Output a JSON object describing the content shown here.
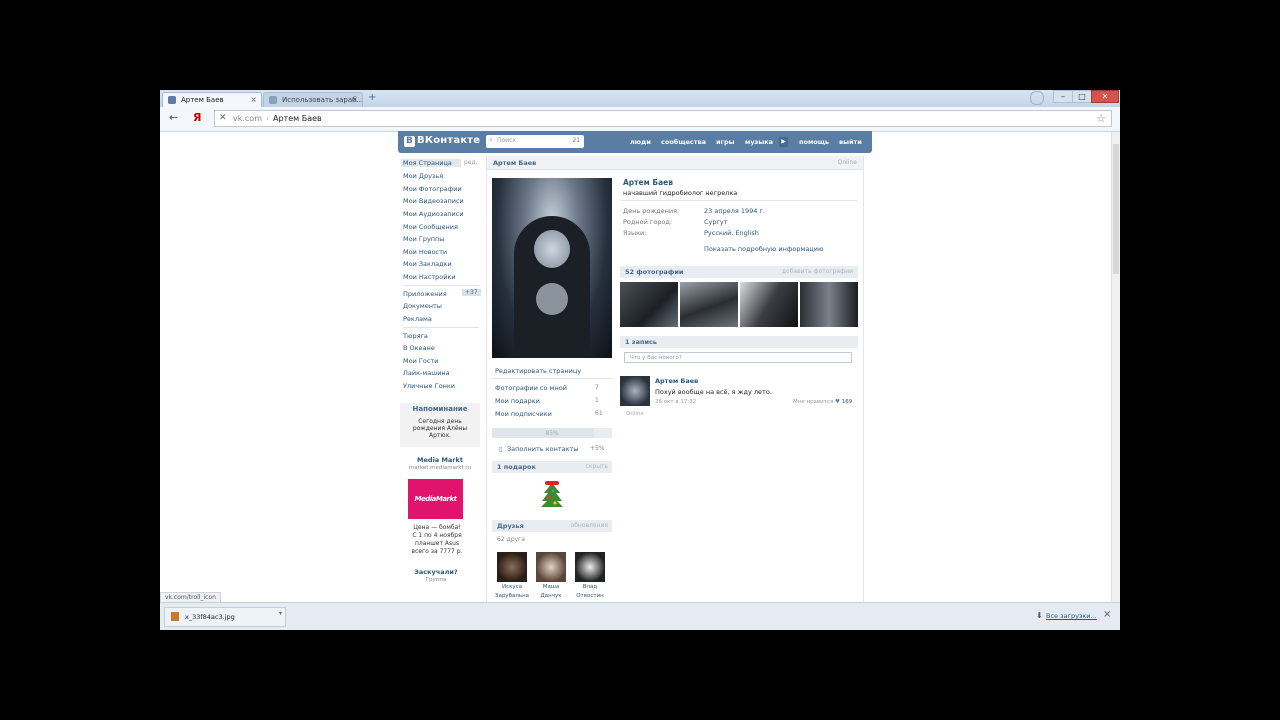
{
  "browser": {
    "tabs": [
      {
        "title": "Артем Баев",
        "active": true
      },
      {
        "title": "Использовать зараб...",
        "active": false
      }
    ],
    "new_tab": "+",
    "address": {
      "domain": "vk.com",
      "separator": "›",
      "title": "Артем Баев"
    },
    "yandex_button": "Я",
    "status_link": "vk.com/troll_icon"
  },
  "vk": {
    "logo": "ВКонтакте",
    "logo_letter": "В",
    "search_placeholder": "Поиск",
    "search_count": "21",
    "nav": [
      "люди",
      "сообщества",
      "игры",
      "музыка",
      "помощь",
      "выйти"
    ],
    "left_menu": [
      "Моя Страница",
      "Мои Друзья",
      "Мои Фотографии",
      "Мои Видеозаписи",
      "Мои Аудиозаписи",
      "Мои Сообщения",
      "Мои Группы",
      "Мои Новости",
      "Мои Закладки",
      "Мои Настройки"
    ],
    "edit_label": "ред.",
    "left_menu_2": [
      "Приложения",
      "Документы",
      "Реклама"
    ],
    "apps_badge": "+37",
    "left_menu_3": [
      "Тюрягa",
      "В Океане",
      "Мои Гости",
      "Лайк-машина",
      "Уличные Гонки"
    ],
    "reminder": {
      "title": "Напоминание",
      "line1": "Сегодня день",
      "line2": "рождения Алёны",
      "line3": "Артюх."
    },
    "ad": {
      "title": "Media Markt",
      "url": "market.mediamarkt.ru",
      "logo": "MediaMarkt",
      "text1": "Цена — бомба!",
      "text2": "С 1 по 4 ноября",
      "text3": "планшет Asus",
      "text4": "всего за 7777 р.",
      "title2": "Заскучали?",
      "sub2": "Группа"
    }
  },
  "profile": {
    "header_name": "Артем Баев",
    "header_status": "Online",
    "name": "Артем Баев",
    "status": "начавший гидробиолог негрелка",
    "info": [
      {
        "label": "День рождения:",
        "value": "23 апреля 1994 г."
      },
      {
        "label": "Родной город:",
        "value": "Сургут"
      },
      {
        "label": "Языки:",
        "value": "Русский, English"
      }
    ],
    "more_info": "Показать подробную информацию",
    "photos_header": "52 фотографии",
    "photos_add": "добавить фотографии",
    "edit_page": "Редактировать страницу",
    "links": [
      {
        "label": "Фотографии со мной",
        "count": "7"
      },
      {
        "label": "Мои подарки",
        "count": "1"
      },
      {
        "label": "Мои подписчики",
        "count": "61"
      }
    ],
    "progress": {
      "label": "85%",
      "value": 0.85
    },
    "fill_contacts": "Заполнить контакты",
    "fill_contacts_bonus": "+5%",
    "gifts_header": "1 подарок",
    "gifts_hide": "скрыть",
    "friends_header": "Друзья",
    "friends_update": "обновления",
    "friends_count": "62 друга",
    "friends": [
      {
        "first": "Искуса",
        "last": "Зарубальна"
      },
      {
        "first": "Маша",
        "last": "Данчук"
      },
      {
        "first": "Влад",
        "last": "Отвостин"
      }
    ],
    "wall_header": "1 запись",
    "wall_placeholder": "Что у Вас нового?",
    "post": {
      "author": "Артем Баев",
      "text": "Похуй вообще на всё, я жду лето.",
      "date": "26 окт в 17:32",
      "likes_label": "Мне нравится",
      "likes_count": "169",
      "online": "Online"
    }
  },
  "downloads": {
    "file": "x_33f84ac3.jpg",
    "all": "Все загрузки..."
  }
}
